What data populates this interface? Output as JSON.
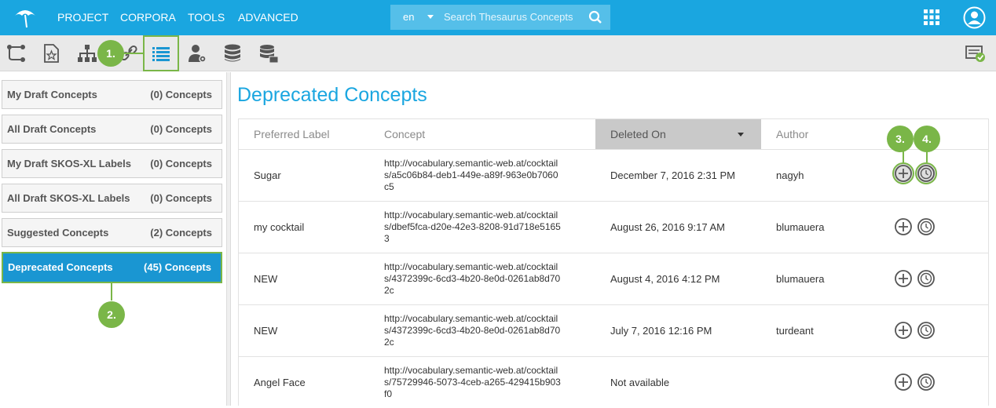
{
  "topbar": {
    "nav": [
      "PROJECT",
      "CORPORA",
      "TOOLS",
      "ADVANCED"
    ],
    "lang": "en",
    "search_placeholder": "Search Thesaurus Concepts",
    "icons": [
      "umbrella-logo-icon",
      "search-icon",
      "apps-grid-icon",
      "user-avatar-icon"
    ]
  },
  "toolbar": {
    "tools": [
      "hierarchy-tree-icon",
      "starred-document-icon",
      "org-chart-icon",
      "link-icon",
      "list-icon",
      "user-settings-icon",
      "database-icon",
      "database-server-icon",
      "validation-icon"
    ],
    "active_tool": "list-icon"
  },
  "callouts": {
    "c1": "1.",
    "c2": "2.",
    "c3": "3.",
    "c4": "4."
  },
  "sidebar": {
    "items": [
      {
        "label": "My Draft Concepts",
        "count": "(0) Concepts"
      },
      {
        "label": "All Draft Concepts",
        "count": "(0) Concepts"
      },
      {
        "label": "My Draft SKOS-XL Labels",
        "count": "(0) Concepts"
      },
      {
        "label": "All Draft SKOS-XL Labels",
        "count": "(0) Concepts"
      },
      {
        "label": "Suggested Concepts",
        "count": "(2) Concepts"
      },
      {
        "label": "Deprecated Concepts",
        "count": "(45) Concepts"
      }
    ],
    "active_index": 5
  },
  "main": {
    "title": "Deprecated Concepts",
    "columns": [
      "Preferred Label",
      "Concept",
      "Deleted On",
      "Author"
    ],
    "sorted_column": "Deleted On",
    "rows": [
      {
        "label": "Sugar",
        "concept": "http://vocabulary.semantic-web.at/cocktails/a5c06b84-deb1-449e-a89f-963e0b7060c5",
        "deleted": "December 7, 2016 2:31 PM",
        "author": "nagyh"
      },
      {
        "label": "my cocktail",
        "concept": "http://vocabulary.semantic-web.at/cocktails/dbef5fca-d20e-42e3-8208-91d718e51653",
        "deleted": "August 26, 2016 9:17 AM",
        "author": "blumauera"
      },
      {
        "label": "NEW",
        "concept": "http://vocabulary.semantic-web.at/cocktails/4372399c-6cd3-4b20-8e0d-0261ab8d702c",
        "deleted": "August 4, 2016 4:12 PM",
        "author": "blumauera"
      },
      {
        "label": "NEW",
        "concept": "http://vocabulary.semantic-web.at/cocktails/4372399c-6cd3-4b20-8e0d-0261ab8d702c",
        "deleted": "July 7, 2016 12:16 PM",
        "author": "turdeant"
      },
      {
        "label": "Angel Face",
        "concept": "http://vocabulary.semantic-web.at/cocktails/75729946-5073-4ceb-a265-429415b903f0",
        "deleted": "Not available",
        "author": ""
      }
    ]
  },
  "colors": {
    "accent": "#1aa6e0",
    "callout": "#7ab648",
    "active_item": "#1a96d2"
  }
}
